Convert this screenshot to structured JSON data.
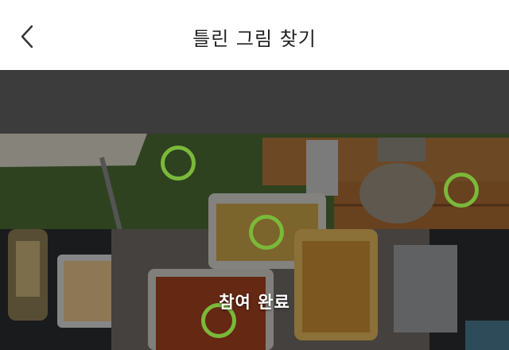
{
  "header": {
    "title": "틀린 그림 찾기",
    "back_icon": "chevron-left-icon"
  },
  "game": {
    "status_text": "참여 완료",
    "marker_color": "#7ab93a",
    "found_count": 4
  },
  "colors": {
    "band": "#3c3c3c",
    "marker": "#7ab93a"
  }
}
